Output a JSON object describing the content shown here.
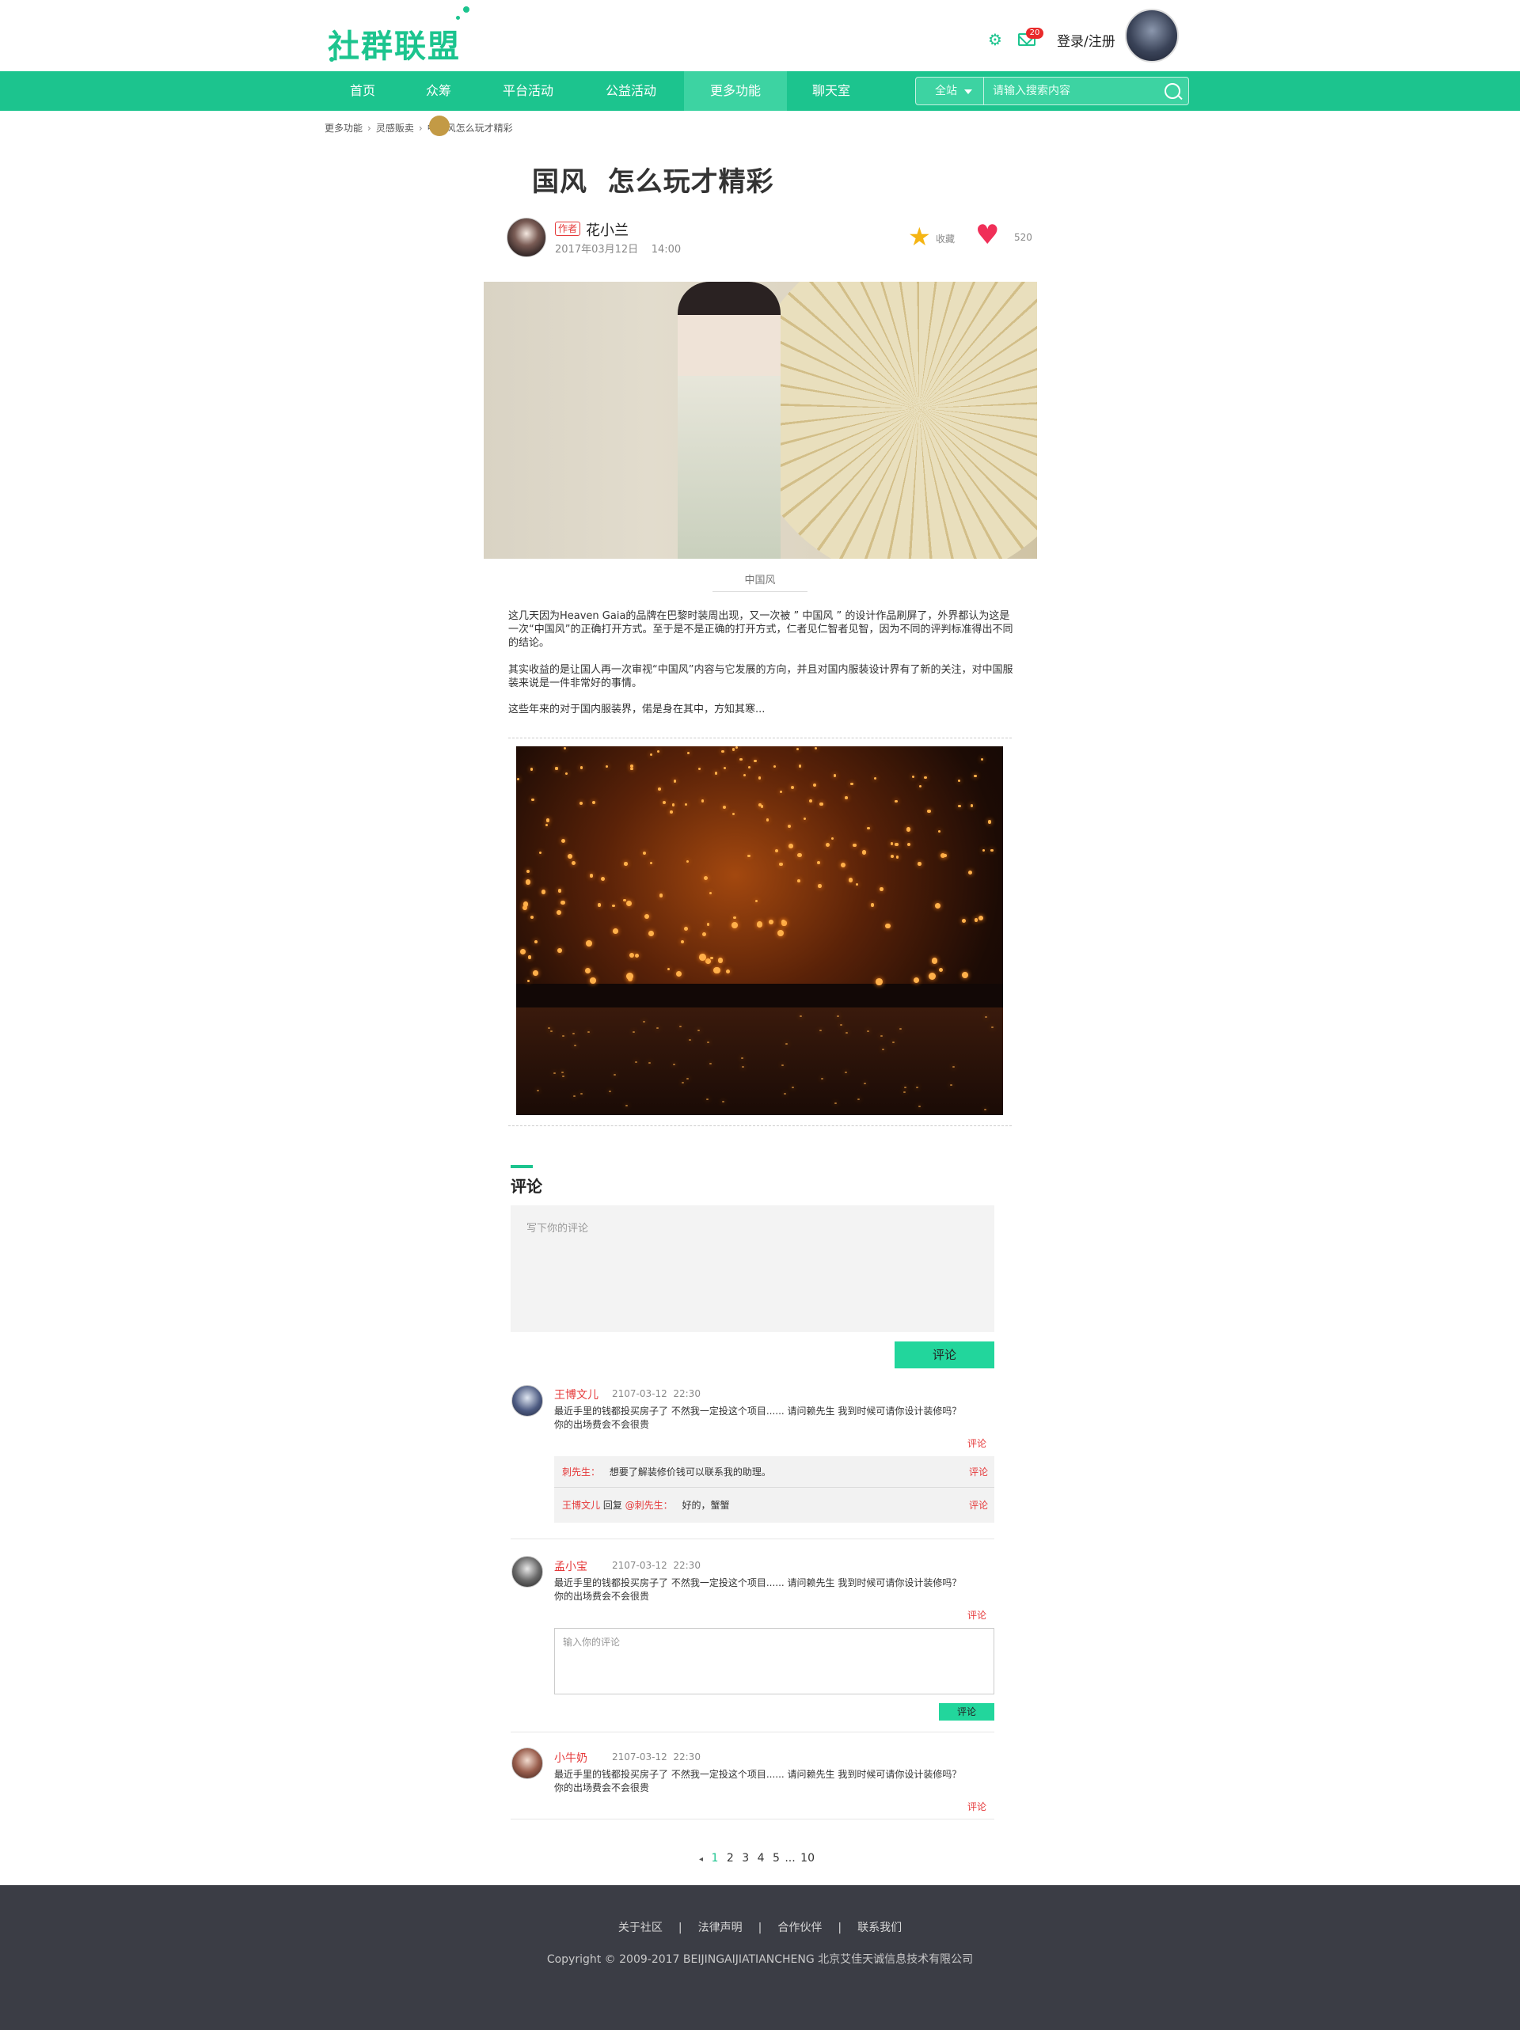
{
  "header": {
    "logo": "社群联盟",
    "mail_badge": "20",
    "login": "登录/注册"
  },
  "nav": {
    "items": [
      "首页",
      "众筹",
      "平台活动",
      "公益活动",
      "更多功能",
      "聊天室"
    ],
    "active_index": 4,
    "search_scope": "全站",
    "search_placeholder": "请输入搜索内容"
  },
  "breadcrumb": [
    "更多功能",
    "灵感贩卖",
    "中国风怎么玩才精彩"
  ],
  "article": {
    "title": "国风  怎么玩才精彩",
    "author_tag": "作者",
    "author_name": "花小兰",
    "date": "2017年03月12日    14:00",
    "fav_label": "收藏",
    "like_count": "520",
    "image_caption": "中国风",
    "paragraphs": [
      "这几天因为Heaven Gaia的品牌在巴黎时装周出现，又一次被 ” 中国风 ” 的设计作品刷屏了，外界都认为这是一次“中国风”的正确打开方式。至于是不是正确的打开方式，仁者见仁智者见智，因为不同的评判标准得出不同的结论。",
      "其实收益的是让国人再一次审视“中国风”内容与它发展的方向，并且对国内服装设计界有了新的关注，对中国服装来说是一件非常好的事情。",
      "这些年来的对于国内服装界，偌是身在其中，方知其寒..."
    ]
  },
  "comments": {
    "title": "评论",
    "placeholder": "写下你的评论",
    "submit": "评论",
    "reply_label": "评论",
    "list": [
      {
        "name": "王博文儿",
        "time": "2107-03-12  22:30",
        "text": "最近手里的钱都投买房子了 不然我一定投这个项目......  请问赖先生 我到时候可请你设计装修吗？你的出场费会不会很贵",
        "replies": [
          {
            "name": "刺先生：",
            "text": "想要了解装修价钱可以联系我的助理。"
          },
          {
            "name": "王博文儿",
            "mid": " 回复 ",
            "target": "@刺先生：",
            "text": "好的，蟹蟹"
          }
        ]
      },
      {
        "name": "孟小宝",
        "time": "2107-03-12  22:30",
        "text": "最近手里的钱都投买房子了 不然我一定投这个项目......  请问赖先生 我到时候可请你设计装修吗？你的出场费会不会很贵",
        "reply_placeholder": "输入你的评论"
      },
      {
        "name": "小牛奶",
        "time": "2107-03-12  22:30",
        "text": "最近手里的钱都投买房子了 不然我一定投这个项目......  请问赖先生 我到时候可请你设计装修吗？你的出场费会不会很贵"
      }
    ]
  },
  "pagination": {
    "prev": "◂",
    "pages": [
      "1",
      "2",
      "3",
      "4",
      "5",
      "...",
      "10"
    ],
    "current": "1"
  },
  "footer": {
    "links": [
      "关于社区",
      "法律声明",
      "合作伙伴",
      "联系我们"
    ],
    "separator": "|",
    "copyright": "Copyright © 2009-2017 BEIJINGAIJIATIANCHENG 北京艾佳天诚信息技术有限公司"
  },
  "colors": {
    "brand": "#1cc48e",
    "accent_red": "#e5393a",
    "footer_bg": "#3b3d45"
  },
  "icons": [
    "gear-icon",
    "mail-icon",
    "search-icon",
    "star-icon",
    "heart-icon",
    "chevron-right-icon"
  ]
}
